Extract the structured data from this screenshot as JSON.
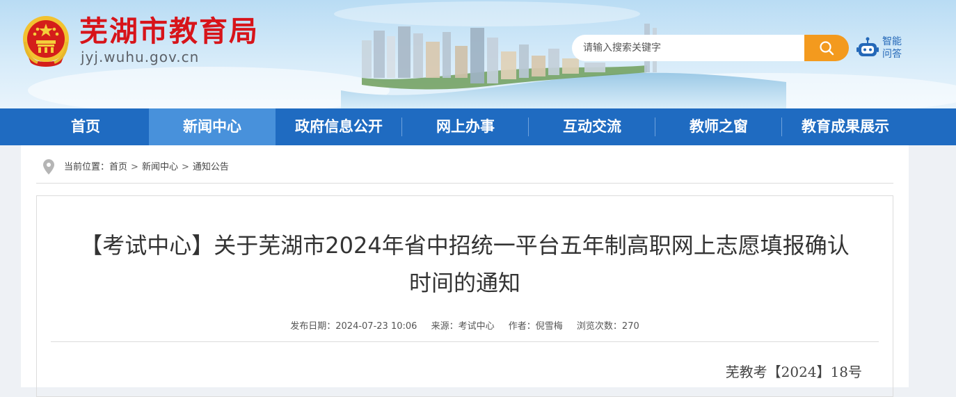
{
  "header": {
    "site_title": "芜湖市教育局",
    "site_domain": "jyj.wuhu.gov.cn",
    "search": {
      "placeholder": "请输入搜索关键字"
    },
    "ai_assistant": {
      "line1": "智能",
      "line2": "问答"
    },
    "icons": {
      "emblem": "national-emblem-icon",
      "search": "search-icon",
      "robot": "robot-icon"
    },
    "colors": {
      "title": "#d7141a",
      "search_button": "#f39a1e"
    }
  },
  "nav": {
    "items": [
      {
        "label": "首页"
      },
      {
        "label": "新闻中心",
        "active": true
      },
      {
        "label": "政府信息公开"
      },
      {
        "label": "网上办事"
      },
      {
        "label": "互动交流"
      },
      {
        "label": "教师之窗"
      },
      {
        "label": "教育成果展示"
      }
    ],
    "colors": {
      "bar": "#1f6bc1",
      "active": "#4891db"
    }
  },
  "breadcrumb": {
    "prefix": "当前位置：",
    "items": [
      "首页",
      "新闻中心",
      "通知公告"
    ],
    "separator": ">"
  },
  "article": {
    "title_line1": "【考试中心】关于芜湖市2024年省中招统一平台五年制高职网上志愿填报确认",
    "title_line2": "时间的通知",
    "meta": {
      "date_label": "发布日期：",
      "date": "2024-07-23 10:06",
      "source_label": "来源：",
      "source": "考试中心",
      "author_label": "作者：",
      "author": "倪雪梅",
      "views_label": "浏览次数：",
      "views": "270"
    },
    "doc_number": "芜教考【2024】18号"
  }
}
